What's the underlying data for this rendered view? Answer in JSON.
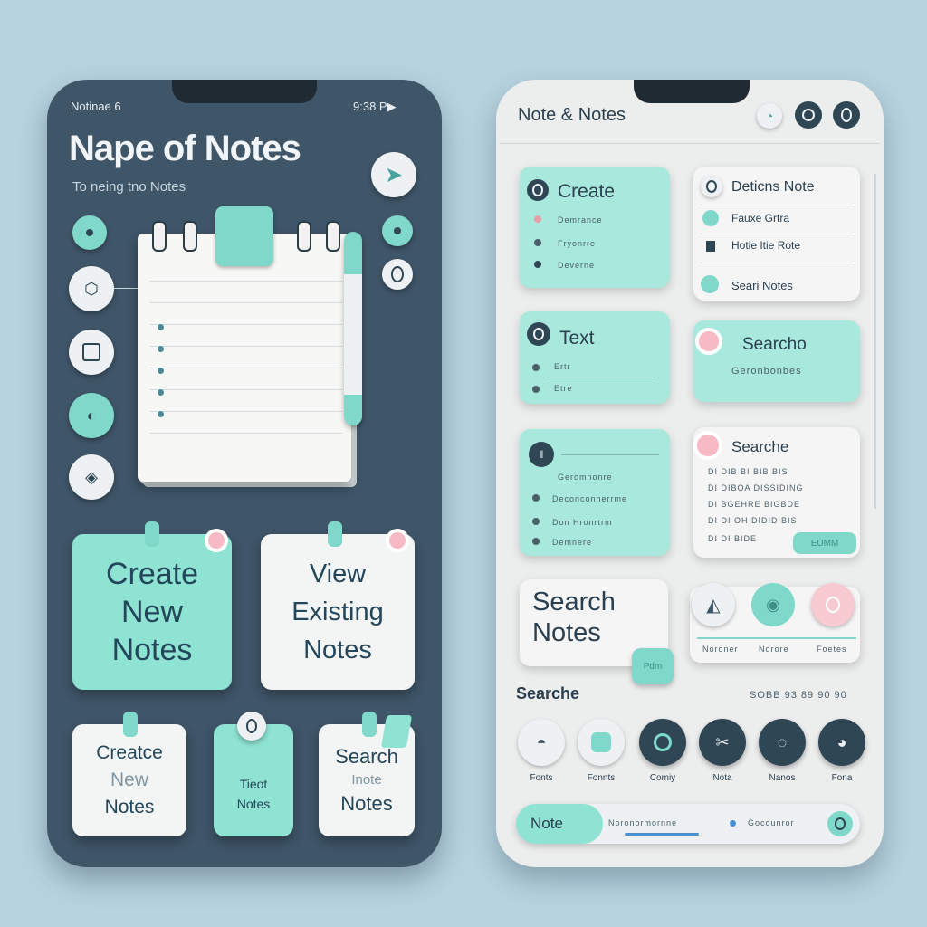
{
  "left_phone": {
    "status_left": "Notinae 6",
    "status_right": "9:38 P▶",
    "title": "Nape of Notes",
    "subtitle": "To neing tno Notes",
    "cards": {
      "create_new": [
        "Create",
        "New",
        "Notes"
      ],
      "view_existing": [
        "View",
        "Existing",
        "Notes"
      ],
      "small_create": [
        "Creatce",
        "New",
        "Notes"
      ],
      "small_text": [
        "Tieot",
        "Notes"
      ],
      "small_search": [
        "Search",
        "Inote",
        "Notes"
      ]
    }
  },
  "right_phone": {
    "title": "Note & Notes",
    "cards": {
      "create": {
        "title": "Create",
        "rows": [
          "Demrance",
          "Fryonrre",
          "Deverne"
        ]
      },
      "delete": {
        "title": "Deticns Note",
        "rows": [
          "Fauxe Grtra",
          "Hotie Itie Rote",
          "Seari Notes"
        ]
      },
      "text": {
        "title": "Text",
        "rows": [
          "Ertr",
          "Etre"
        ]
      },
      "search_top": {
        "title": "Searcho",
        "sub": "Geronbonbes"
      },
      "list": {
        "rows": [
          "Geromnonre",
          "Deconconnerrme",
          "Don Hronrtrm",
          "Demnere"
        ]
      },
      "searche": {
        "title": "Searche",
        "lines": [
          "DI DIB BI BIB BIS",
          "DI DIBOA DISSIDING",
          "DI BGEHRE BIGBDE",
          "DI DI OH DIDID BIS",
          "DI DI BIDE"
        ],
        "button": "EUMM"
      },
      "search_notes": {
        "title": [
          "Search",
          "Notes"
        ],
        "badge": "Pdm"
      },
      "icon_row_labels": [
        "Noroner",
        "Norore",
        "Foetes"
      ]
    },
    "section_label": "Searche",
    "section_meta": "SOBB 93 89 90 90",
    "bottom_labels": [
      "Fonts",
      "Fonnts",
      "Comiy",
      "Nota",
      "Nanos",
      "Fona"
    ],
    "search_bar": {
      "label": "Note",
      "text": "Noronormornne",
      "text2": "Gocounror"
    }
  },
  "colors": {
    "background": "#b7d3df",
    "dark_panel": "#3f5568",
    "mint": "#7fd8c9",
    "pink": "#f7b9c3",
    "light": "#eceded"
  }
}
